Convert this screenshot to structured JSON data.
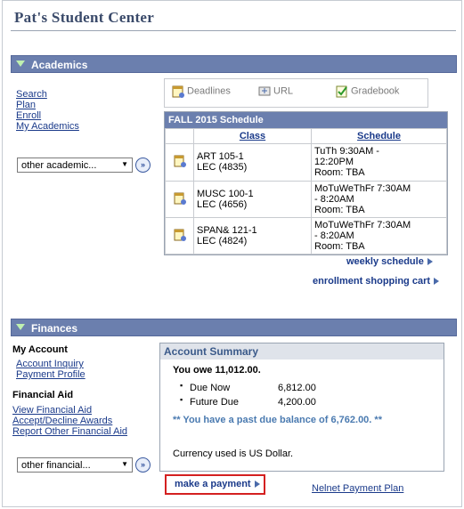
{
  "page_title": "Pat's Student Center",
  "academics": {
    "bar_label": "Academics",
    "links": [
      "Search",
      "Plan",
      "Enroll",
      "My Academics"
    ],
    "dropdown_value": "other academic...",
    "tools": {
      "deadlines": "Deadlines",
      "url": "URL",
      "gradebook": "Gradebook"
    },
    "schedule": {
      "title": "FALL 2015 Schedule",
      "col_class": "Class",
      "col_schedule": "Schedule",
      "rows": [
        {
          "class_line1": "ART 105-1",
          "class_line2": "LEC (4835)",
          "sched_line1": "TuTh 9:30AM -",
          "sched_line2": "12:20PM",
          "sched_line3": "Room:  TBA"
        },
        {
          "class_line1": "MUSC 100-1",
          "class_line2": "LEC (4656)",
          "sched_line1": "MoTuWeThFr 7:30AM",
          "sched_line2": "- 8:20AM",
          "sched_line3": "Room:  TBA"
        },
        {
          "class_line1": "SPAN& 121-1",
          "class_line2": "LEC (4824)",
          "sched_line1": "MoTuWeThFr 7:30AM",
          "sched_line2": "- 8:20AM",
          "sched_line3": "Room:  TBA"
        }
      ]
    },
    "weekly_schedule": "weekly schedule",
    "shopping_cart": "enrollment shopping cart"
  },
  "finances": {
    "bar_label": "Finances",
    "my_account_heading": "My Account",
    "my_account_links": [
      "Account Inquiry",
      "Payment Profile"
    ],
    "fin_aid_heading": "Financial Aid",
    "fin_aid_links": [
      "View Financial Aid",
      "Accept/Decline Awards",
      "Report Other Financial Aid"
    ],
    "dropdown_value": "other financial...",
    "summary": {
      "title": "Account Summary",
      "you_owe": "You owe 11,012.00.",
      "due_now_label": "Due Now",
      "due_now_value": "6,812.00",
      "future_due_label": "Future Due",
      "future_due_value": "4,200.00",
      "past_due": "** You have a past due balance of 6,762.00. **",
      "currency": "Currency used is US Dollar."
    },
    "make_payment": "make a payment",
    "nelnet": "Nelnet Payment Plan"
  },
  "colors": {
    "section_bar": "#6b7fae",
    "link": "#1a3a8a",
    "highlight": "#d42020"
  }
}
